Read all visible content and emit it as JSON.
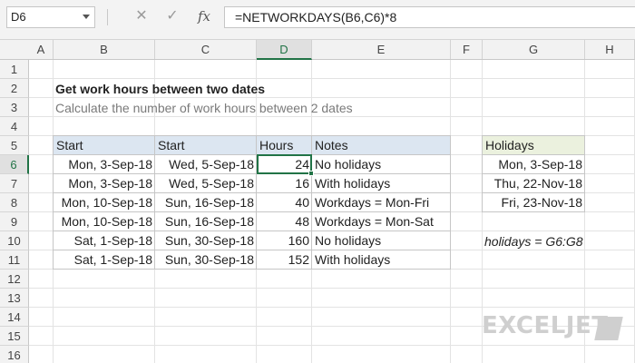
{
  "formula_bar": {
    "name_box": "D6",
    "cancel_icon": "✕",
    "enter_icon": "✓",
    "fx_label": "fx",
    "formula": "=NETWORKDAYS(B6,C6)*8"
  },
  "columns": [
    "A",
    "B",
    "C",
    "D",
    "E",
    "F",
    "G",
    "H"
  ],
  "rows": [
    "1",
    "2",
    "3",
    "4",
    "5",
    "6",
    "7",
    "8",
    "9",
    "10",
    "11",
    "12",
    "13",
    "14",
    "15",
    "16"
  ],
  "sheet": {
    "title": "Get work hours between two dates",
    "subtitle": "Calculate the number of work hours between 2 dates",
    "table": {
      "headers": [
        "Start",
        "Start",
        "Hours",
        "Notes"
      ],
      "rows": [
        [
          "Mon, 3-Sep-18",
          "Wed, 5-Sep-18",
          "24",
          "No holidays"
        ],
        [
          "Mon, 3-Sep-18",
          "Wed, 5-Sep-18",
          "16",
          "With holidays"
        ],
        [
          "Mon, 10-Sep-18",
          "Sun, 16-Sep-18",
          "40",
          "Workdays = Mon-Fri"
        ],
        [
          "Mon, 10-Sep-18",
          "Sun, 16-Sep-18",
          "48",
          "Workdays = Mon-Sat"
        ],
        [
          "Sat, 1-Sep-18",
          "Sun, 30-Sep-18",
          "160",
          "No holidays"
        ],
        [
          "Sat, 1-Sep-18",
          "Sun, 30-Sep-18",
          "152",
          "With holidays"
        ]
      ]
    },
    "holidays": {
      "header": "Holidays",
      "values": [
        "Mon, 3-Sep-18",
        "Thu, 22-Nov-18",
        "Fri, 23-Nov-18"
      ]
    },
    "named_range_note": "holidays = G6:G8"
  },
  "selection": {
    "active_cell": "D6",
    "active_column": "D",
    "active_row": "6"
  },
  "colors": {
    "accent": "#217346",
    "table_header": "#dce6f1",
    "holiday_header": "#ebf1de"
  },
  "logo": {
    "text": "EXCELJET",
    "icon": "exceljet-logo-icon"
  }
}
